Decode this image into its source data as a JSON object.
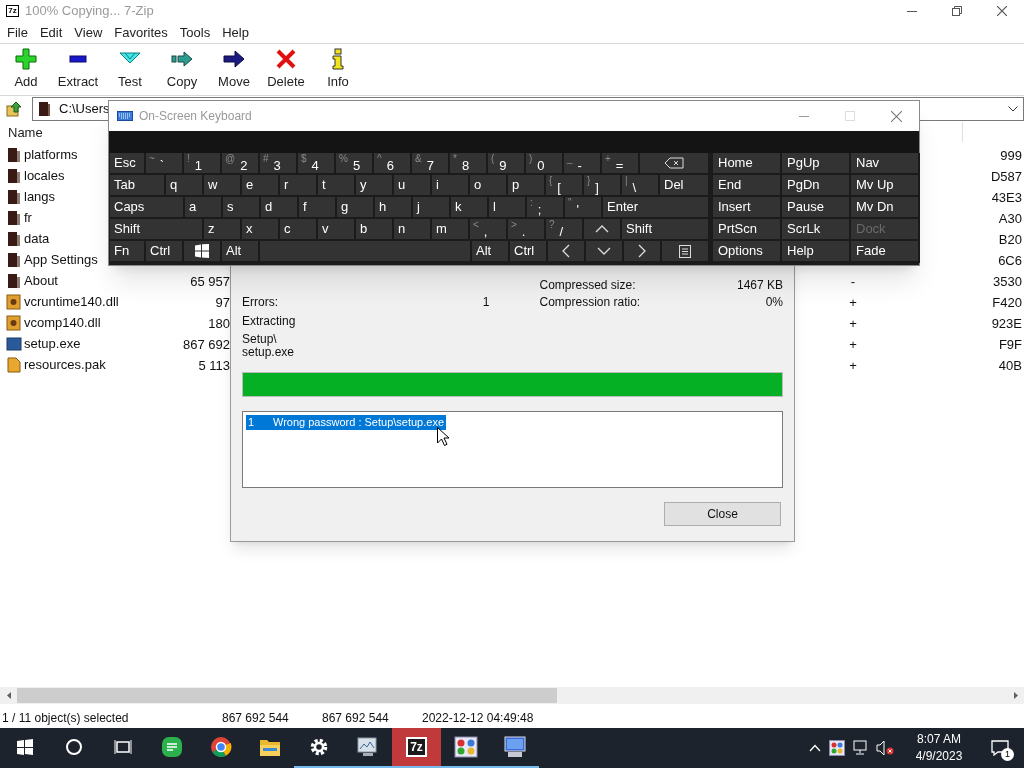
{
  "window": {
    "logo": "7z",
    "title": "100% Copying... 7-Zip"
  },
  "menu": [
    "File",
    "Edit",
    "View",
    "Favorites",
    "Tools",
    "Help"
  ],
  "toolbar": [
    {
      "label": "Add",
      "kind": "add"
    },
    {
      "label": "Extract",
      "kind": "extract"
    },
    {
      "label": "Test",
      "kind": "test"
    },
    {
      "label": "Copy",
      "kind": "copy"
    },
    {
      "label": "Move",
      "kind": "move"
    },
    {
      "label": "Delete",
      "kind": "delete"
    },
    {
      "label": "Info",
      "kind": "info"
    }
  ],
  "address": {
    "path": "C:\\Users"
  },
  "file_list": {
    "columns": [
      "Name"
    ],
    "rows": [
      {
        "name": "platforms",
        "kind": "folder",
        "column_4": "999"
      },
      {
        "name": "locales",
        "kind": "folder",
        "column_4": "D587"
      },
      {
        "name": "langs",
        "kind": "folder",
        "column_4": "43E3"
      },
      {
        "name": "fr",
        "kind": "folder",
        "column_4": "A30"
      },
      {
        "name": "data",
        "kind": "folder",
        "column_4": "B20"
      },
      {
        "name": "App Settings",
        "kind": "folder",
        "column_4": "6C6"
      },
      {
        "name": "About",
        "kind": "folder",
        "column_2": "65 957",
        "column_3": "-",
        "column_4": "3530"
      },
      {
        "name": "vcruntime140.dll",
        "kind": "dll",
        "column_2": "97",
        "column_3": "+",
        "column_4": "F420"
      },
      {
        "name": "vcomp140.dll",
        "kind": "dll",
        "column_2": "180",
        "column_3": "+",
        "column_4": "923E"
      },
      {
        "name": "setup.exe",
        "kind": "exe",
        "column_2": "867 692",
        "column_3": "+",
        "column_4": "F9F"
      },
      {
        "name": "resources.pak",
        "kind": "pak",
        "column_2": "5 113",
        "column_3": "+",
        "column_4": "40B"
      }
    ]
  },
  "status_bar": [
    "1 / 11 object(s) selected",
    "867 692 544",
    "867 692 544",
    "2022-12-12 04:49:48"
  ],
  "progress_dialog": {
    "stats": [
      {
        "right_label": "Compressed size:",
        "right_value": "1467 KB"
      },
      {
        "left_label": "Errors:",
        "left_value": "1",
        "right_label": "Compression ratio:",
        "right_value": "0%"
      }
    ],
    "operation": "Extracting",
    "file_lines": [
      "Setup\\",
      "setup.exe"
    ],
    "level": 1,
    "messages": [
      {
        "number": "1",
        "text": "Wrong password : Setup\\setup.exe",
        "selected": true
      }
    ],
    "close_button": "Close"
  },
  "keyboard": {
    "title": "On-Screen Keyboard",
    "rows": [
      {
        "keys": [
          {
            "kind": "text",
            "label": "Esc"
          },
          {
            "kind": "dual",
            "shift": "~",
            "label": "`"
          },
          {
            "kind": "dual",
            "shift": "!",
            "label": "1"
          },
          {
            "kind": "dual",
            "shift": "@",
            "label": "2"
          },
          {
            "kind": "dual",
            "shift": "#",
            "label": "3"
          },
          {
            "kind": "dual",
            "shift": "$",
            "label": "4"
          },
          {
            "kind": "dual",
            "shift": "%",
            "label": "5"
          },
          {
            "kind": "dual",
            "shift": "^",
            "label": "6"
          },
          {
            "kind": "dual",
            "shift": "&",
            "label": "7"
          },
          {
            "kind": "dual",
            "shift": "*",
            "label": "8"
          },
          {
            "kind": "dual",
            "shift": "(",
            "label": "9"
          },
          {
            "kind": "dual",
            "shift": ")",
            "label": "0"
          },
          {
            "kind": "dual",
            "shift": "_",
            "label": "-"
          },
          {
            "kind": "dual",
            "shift": "+",
            "label": "="
          },
          {
            "kind": "backspace"
          }
        ]
      },
      {
        "keys": [
          {
            "kind": "text",
            "label": "Tab"
          },
          {
            "kind": "text",
            "label": "q"
          },
          {
            "kind": "text",
            "label": "w"
          },
          {
            "kind": "text",
            "label": "e"
          },
          {
            "kind": "text",
            "label": "r"
          },
          {
            "kind": "text",
            "label": "t"
          },
          {
            "kind": "text",
            "label": "y"
          },
          {
            "kind": "text",
            "label": "u"
          },
          {
            "kind": "text",
            "label": "i"
          },
          {
            "kind": "text",
            "label": "o"
          },
          {
            "kind": "text",
            "label": "p"
          },
          {
            "kind": "dual",
            "shift": "{",
            "label": "["
          },
          {
            "kind": "dual",
            "shift": "}",
            "label": "]"
          },
          {
            "kind": "dual",
            "shift": "|",
            "label": "\\"
          },
          {
            "kind": "text",
            "label": "Del"
          }
        ]
      },
      {
        "keys": [
          {
            "kind": "text",
            "label": "Caps"
          },
          {
            "kind": "text",
            "label": "a"
          },
          {
            "kind": "text",
            "label": "s"
          },
          {
            "kind": "text",
            "label": "d"
          },
          {
            "kind": "text",
            "label": "f"
          },
          {
            "kind": "text",
            "label": "g"
          },
          {
            "kind": "text",
            "label": "h"
          },
          {
            "kind": "text",
            "label": "j"
          },
          {
            "kind": "text",
            "label": "k"
          },
          {
            "kind": "text",
            "label": "l"
          },
          {
            "kind": "dual",
            "shift": ":",
            "label": ";"
          },
          {
            "kind": "dual",
            "shift": "\"",
            "label": "'"
          },
          {
            "kind": "text",
            "label": "Enter"
          }
        ]
      },
      {
        "keys": [
          {
            "kind": "text",
            "label": "Shift"
          },
          {
            "kind": "text",
            "label": "z"
          },
          {
            "kind": "text",
            "label": "x"
          },
          {
            "kind": "text",
            "label": "c"
          },
          {
            "kind": "text",
            "label": "v"
          },
          {
            "kind": "text",
            "label": "b"
          },
          {
            "kind": "text",
            "label": "n"
          },
          {
            "kind": "text",
            "label": "m"
          },
          {
            "kind": "dual",
            "shift": "<",
            "label": ","
          },
          {
            "kind": "dual",
            "shift": ">",
            "label": "."
          },
          {
            "kind": "dual",
            "shift": "?",
            "label": "/"
          },
          {
            "kind": "up"
          },
          {
            "kind": "text",
            "label": "Shift"
          }
        ]
      },
      {
        "keys": [
          {
            "kind": "text",
            "label": "Fn"
          },
          {
            "kind": "text",
            "label": "Ctrl"
          },
          {
            "kind": "windows"
          },
          {
            "kind": "text",
            "label": "Alt"
          },
          {
            "kind": "space"
          },
          {
            "kind": "text",
            "label": "Alt"
          },
          {
            "kind": "text",
            "label": "Ctrl"
          },
          {
            "kind": "left"
          },
          {
            "kind": "down"
          },
          {
            "kind": "right"
          },
          {
            "kind": "menu"
          }
        ]
      }
    ],
    "side_rows": [
      [
        {
          "label": "Home",
          "disabled": false
        },
        {
          "label": "PgUp",
          "disabled": false
        },
        {
          "label": "Nav",
          "disabled": false
        }
      ],
      [
        {
          "label": "End",
          "disabled": false
        },
        {
          "label": "PgDn",
          "disabled": false
        },
        {
          "label": "Mv Up",
          "disabled": false
        }
      ],
      [
        {
          "label": "Insert",
          "disabled": false
        },
        {
          "label": "Pause",
          "disabled": false
        },
        {
          "label": "Mv Dn",
          "disabled": false
        }
      ],
      [
        {
          "label": "PrtScn",
          "disabled": false
        },
        {
          "label": "ScrLk",
          "disabled": false
        },
        {
          "label": "Dock",
          "disabled": true
        }
      ],
      [
        {
          "label": "Options",
          "disabled": false
        },
        {
          "label": "Help",
          "disabled": false
        },
        {
          "label": "Fade",
          "disabled": false
        }
      ]
    ]
  },
  "taskbar": {
    "items": [
      {
        "kind": "start",
        "running": false,
        "selected": false
      },
      {
        "kind": "search",
        "running": false,
        "selected": false
      },
      {
        "kind": "task-view",
        "running": false,
        "selected": false
      },
      {
        "kind": "notes",
        "running": false,
        "selected": false
      },
      {
        "kind": "browser",
        "running": false,
        "selected": false
      },
      {
        "kind": "folder",
        "running": false,
        "selected": false
      },
      {
        "kind": "gear",
        "running": true,
        "selected": false
      },
      {
        "kind": "monitor",
        "running": true,
        "selected": false
      },
      {
        "kind": "archiver",
        "label": "7z",
        "running": true,
        "selected": true
      },
      {
        "kind": "tiles",
        "running": true,
        "selected": false
      },
      {
        "kind": "computer",
        "running": true,
        "selected": false
      }
    ],
    "time": "8:07 AM",
    "date": "4/9/2023",
    "notifications": "1"
  }
}
